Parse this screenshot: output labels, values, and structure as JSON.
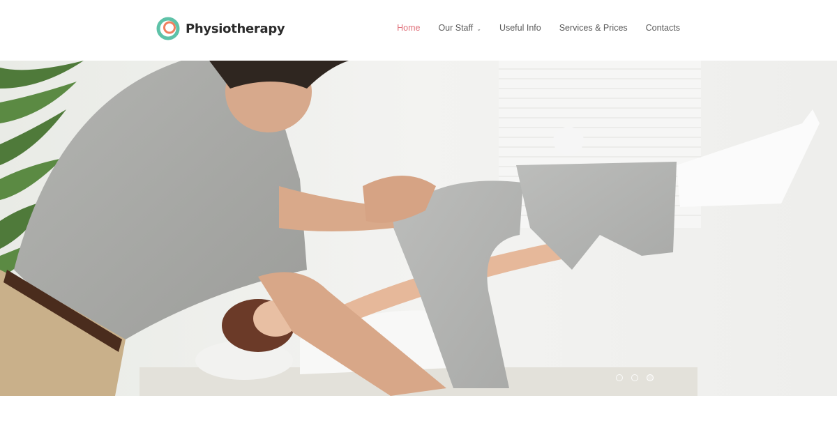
{
  "brand": {
    "name": "Physiotherapy",
    "logo_colors": {
      "outer": "#5ec2a8",
      "inner": "#f07f5e"
    }
  },
  "nav": {
    "items": [
      {
        "label": "Home",
        "active": true
      },
      {
        "label": "Our Staff",
        "dropdown": true
      },
      {
        "label": "Useful Info"
      },
      {
        "label": "Services & Prices"
      },
      {
        "label": "Contacts"
      }
    ],
    "active_color": "#e0707a"
  },
  "hero": {
    "image": "physiotherapist stretching a patient's leg on a treatment table",
    "slides_count": 3,
    "active_slide": 3
  }
}
